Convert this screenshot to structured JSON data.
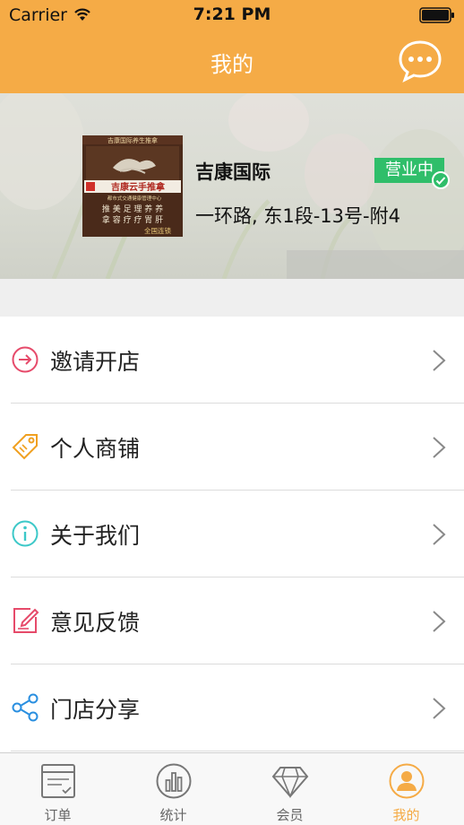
{
  "status_bar": {
    "carrier": "Carrier",
    "time": "7:21 PM"
  },
  "nav": {
    "title": "我的",
    "chat_icon": "chat-bubble-icon"
  },
  "store": {
    "name": "吉康国际",
    "address": "一环路, 东1段-13号-附4",
    "status": "营业中",
    "photo": {
      "sign_top": "吉康国际养生推拿",
      "sign_brand": "吉康云手推拿",
      "sign_sub": "都市式交通健康管理中心",
      "sign_row1": "推 美 足 理 养 养",
      "sign_row2": "拿 容 疗 疗 胃 肝",
      "sign_chain": "全国连锁"
    }
  },
  "menu": [
    {
      "label": "邀请开店",
      "icon": "arrow-circle-icon",
      "color": "#e64a6a"
    },
    {
      "label": "个人商铺",
      "icon": "tag-icon",
      "color": "#f0a020"
    },
    {
      "label": "关于我们",
      "icon": "info-icon",
      "color": "#3cc8c8"
    },
    {
      "label": "意见反馈",
      "icon": "edit-icon",
      "color": "#e64a6a"
    },
    {
      "label": "门店分享",
      "icon": "share-icon",
      "color": "#2a8fe0"
    }
  ],
  "tabs": [
    {
      "label": "订单",
      "icon": "order-icon",
      "active": false
    },
    {
      "label": "统计",
      "icon": "stats-icon",
      "active": false
    },
    {
      "label": "会员",
      "icon": "diamond-icon",
      "active": false
    },
    {
      "label": "我的",
      "icon": "user-icon",
      "active": true
    }
  ],
  "colors": {
    "primary": "#f5ab46",
    "badge": "#2fbe6a"
  }
}
